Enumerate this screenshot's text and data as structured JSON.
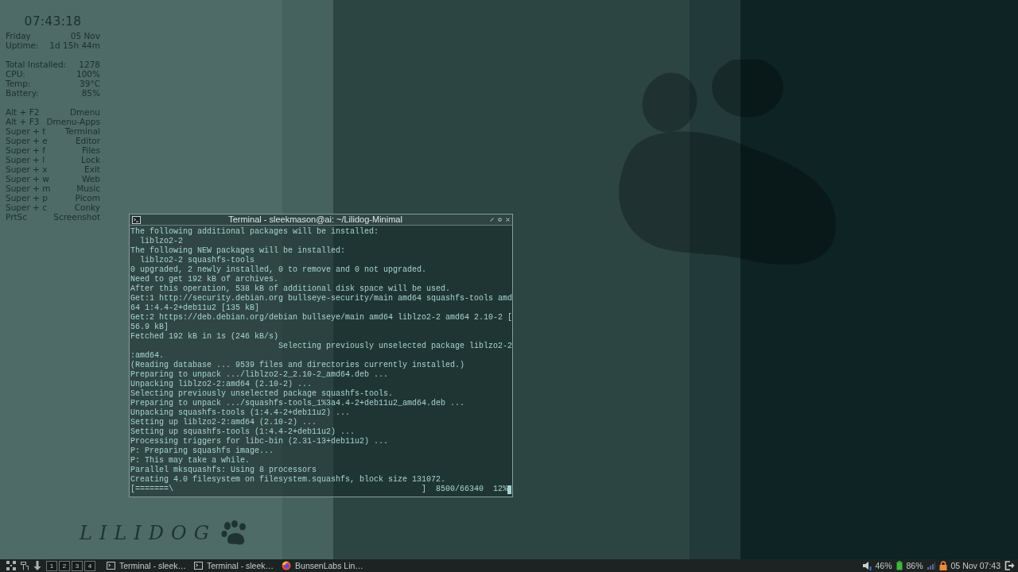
{
  "conky": {
    "clock": "07:43:18",
    "sections": [
      [
        {
          "label": "Friday",
          "value": "05 Nov"
        },
        {
          "label": "Uptime:",
          "value": "1d 15h 44m"
        }
      ],
      [
        {
          "label": "Total Installed:",
          "value": "1278"
        },
        {
          "label": "CPU:",
          "value": "100%"
        },
        {
          "label": "Temp:",
          "value": "39°C"
        },
        {
          "label": "Battery:",
          "value": "85%"
        }
      ],
      [
        {
          "label": "Alt + F2",
          "value": "Dmenu"
        },
        {
          "label": "Alt + F3",
          "value": "Dmenu-Apps"
        },
        {
          "label": "Super + t",
          "value": "Terminal"
        },
        {
          "label": "Super + e",
          "value": "Editor"
        },
        {
          "label": "Super + f",
          "value": "Files"
        },
        {
          "label": "Super + l",
          "value": "Lock"
        },
        {
          "label": "Super + x",
          "value": "Exit"
        },
        {
          "label": "Super + w",
          "value": "Web"
        },
        {
          "label": "Super + m",
          "value": "Music"
        },
        {
          "label": "Super + p",
          "value": "Picom"
        },
        {
          "label": "Super + c",
          "value": "Conky"
        },
        {
          "label": "PrtSc",
          "value": "Screenshot"
        }
      ]
    ]
  },
  "logo": {
    "text": "LILIDOG"
  },
  "terminal": {
    "title": "Terminal - sleekmason@ai: ~/Lilidog-Minimal",
    "lines": [
      "The following additional packages will be installed:",
      "  liblzo2-2",
      "The following NEW packages will be installed:",
      "  liblzo2-2 squashfs-tools",
      "0 upgraded, 2 newly installed, 0 to remove and 0 not upgraded.",
      "Need to get 192 kB of archives.",
      "After this operation, 538 kB of additional disk space will be used.",
      "Get:1 http://security.debian.org bullseye-security/main amd64 squashfs-tools amd",
      "64 1:4.4-2+deb11u2 [135 kB]",
      "Get:2 https://deb.debian.org/debian bullseye/main amd64 liblzo2-2 amd64 2.10-2 [",
      "56.9 kB]",
      "Fetched 192 kB in 1s (246 kB/s)",
      "                               Selecting previously unselected package liblzo2-2",
      ":amd64.",
      "(Reading database ... 9539 files and directories currently installed.)",
      "Preparing to unpack .../liblzo2-2_2.10-2_amd64.deb ...",
      "Unpacking liblzo2-2:amd64 (2.10-2) ...",
      "Selecting previously unselected package squashfs-tools.",
      "Preparing to unpack .../squashfs-tools_1%3a4.4-2+deb11u2_amd64.deb ...",
      "Unpacking squashfs-tools (1:4.4-2+deb11u2) ...",
      "Setting up liblzo2-2:amd64 (2.10-2) ...",
      "Setting up squashfs-tools (1:4.4-2+deb11u2) ...",
      "Processing triggers for libc-bin (2.31-13+deb11u2) ...",
      "P: Preparing squashfs image...",
      "P: This may take a while.",
      "Parallel mksquashfs: Using 8 processors",
      "Creating 4.0 filesystem on filesystem.squashfs, block size 131072.",
      "[=======\\                                                    ]  8500/66340  12%"
    ]
  },
  "taskbar": {
    "workspaces": [
      "1",
      "2",
      "3",
      "4"
    ],
    "tasks": [
      {
        "kind": "terminal",
        "label": "Terminal - sleek…"
      },
      {
        "kind": "terminal",
        "label": "Terminal - sleek…"
      },
      {
        "kind": "browser",
        "label": "BunsenLabs Lin…"
      }
    ],
    "volume": "46%",
    "battery": "86%",
    "datetime": "05 Nov 07:43"
  }
}
